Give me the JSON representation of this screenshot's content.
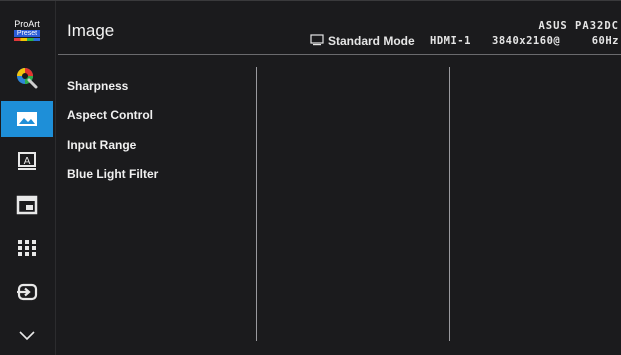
{
  "brand": {
    "line1": "ProArt",
    "line2": "Preset"
  },
  "header": {
    "title": "Image",
    "model": "ASUS PA32DC",
    "mode_label": "Standard Mode",
    "input": "HDMI-1",
    "resolution": "3840x2160@",
    "refresh": "60Hz"
  },
  "rail": {
    "items": [
      {
        "name": "proart-preset",
        "icon": "proart-logo"
      },
      {
        "name": "color",
        "icon": "color-palette-icon"
      },
      {
        "name": "image",
        "icon": "image-icon",
        "active": true
      },
      {
        "name": "input-label",
        "icon": "input-label-icon"
      },
      {
        "name": "pip-pbp",
        "icon": "pip-icon"
      },
      {
        "name": "system",
        "icon": "grid-icon"
      },
      {
        "name": "input-select",
        "icon": "input-select-icon"
      },
      {
        "name": "more",
        "icon": "chevron-down-icon"
      }
    ]
  },
  "menu": {
    "items": [
      "Sharpness",
      "Aspect Control",
      "Input Range",
      "Blue Light Filter"
    ]
  },
  "colors": {
    "accent": "#1e8fd8",
    "background": "#1b1b1d"
  }
}
